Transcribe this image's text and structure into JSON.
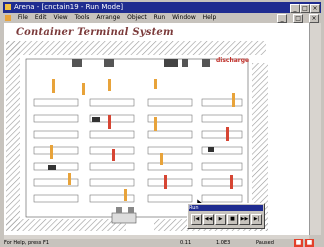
{
  "window": {
    "title": "Arena - [cnctain19 - Run Mode]",
    "controls": [
      "_",
      "□",
      "×"
    ]
  },
  "menubar": {
    "items": [
      "File",
      "Edit",
      "View",
      "Tools",
      "Arrange",
      "Object",
      "Run",
      "Window",
      "Help"
    ],
    "mdi_controls": [
      "_",
      "□",
      "×"
    ]
  },
  "canvas": {
    "title": "Container Terminal System",
    "discharge_label": "discharge"
  },
  "statusbar": {
    "left": "For Help, press F1",
    "mid1": "0.11",
    "mid2": "1.0E3",
    "mid3": "Paused"
  },
  "control_panel": {
    "title": "Run",
    "buttons": [
      "|◀",
      "◀◀",
      "▶",
      "■",
      "▶▶",
      "▶|"
    ]
  },
  "colors": {
    "titlebar": "#1f2c90",
    "chrome": "#c7c3bd",
    "title_text": "#7b3a3a",
    "wall_hatch": "#8b8b8b",
    "container_orange": "#e8a33a",
    "container_red": "#d64533",
    "crane": "#333333"
  }
}
